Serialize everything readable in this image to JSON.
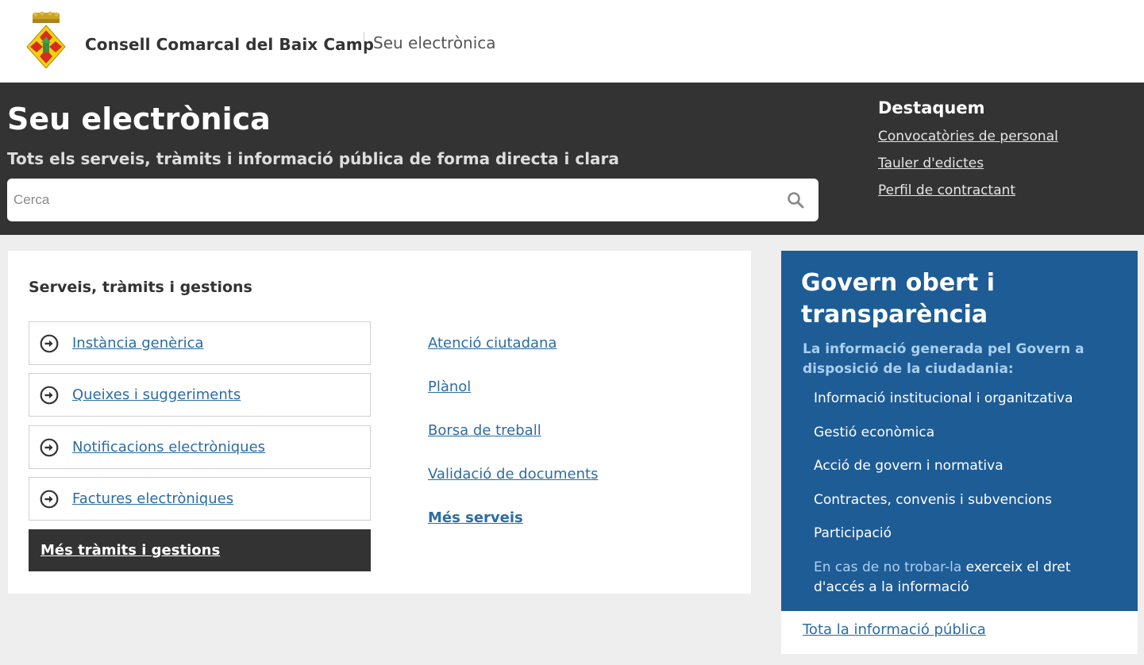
{
  "header": {
    "org_name": "Consell Comarcal del Baix Camp",
    "site_name": "Seu electrònica"
  },
  "hero": {
    "title": "Seu electrònica",
    "subtitle": "Tots els serveis, tràmits i informació pública de forma directa i clara",
    "search_placeholder": "Cerca",
    "search_value": ""
  },
  "featured": {
    "title": "Destaquem",
    "links": [
      "Convocatòries de personal",
      "Tauler d'edictes",
      "Perfil de contractant"
    ]
  },
  "services": {
    "title": "Serveis, tràmits i gestions",
    "procedures": [
      "Instància genèrica",
      "Queixes i suggeriments",
      "Notificacions electròniques",
      "Factures electròniques"
    ],
    "more_procedures": "Més tràmits i gestions",
    "links": [
      "Atenció ciutadana",
      "Plànol",
      "Borsa de treball",
      "Validació de documents"
    ],
    "more_services": "Més serveis"
  },
  "govern": {
    "title": "Govern obert i transparència",
    "intro": "La informació generada pel Govern a disposició de la ciudadania:",
    "links": [
      "Informació institucional i organitzativa",
      "Gestió econòmica",
      "Acció de govern i normativa",
      "Contractes, convenis i subvencions",
      "Participació"
    ],
    "request_prefix": "En cas de no trobar-la",
    "request_link": "exerceix el dret d'accés a la informació",
    "footer_link": "Tota la informació pública"
  },
  "colors": {
    "hero_bg": "#333333",
    "page_bg": "#eeeeee",
    "link": "#2d6ca2",
    "govern_bg": "#1e5c96",
    "govern_light": "#a9d0f0"
  },
  "icons": {
    "logo": "coat-of-arms",
    "search": "search-icon",
    "procedure_arrow": "arrow-circle-right-icon"
  }
}
